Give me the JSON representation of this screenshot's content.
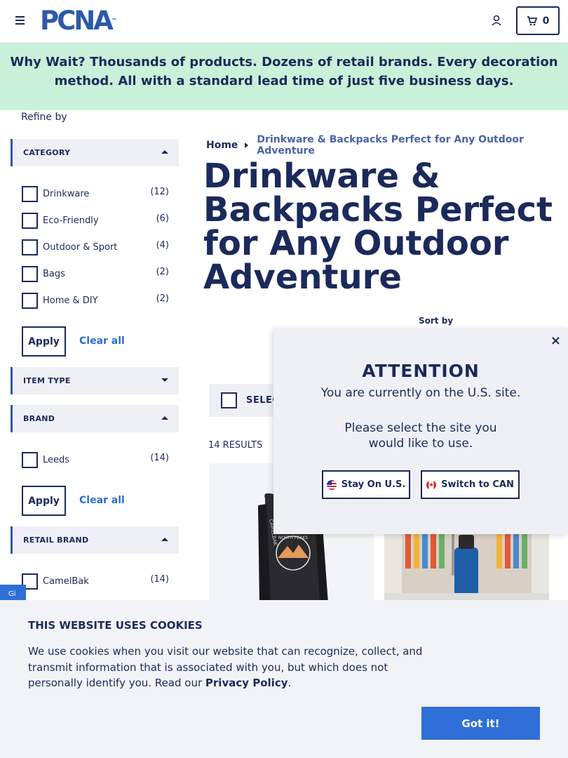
{
  "header": {
    "logo_text": "PCNA",
    "logo_mark": "™",
    "cart_count": "0"
  },
  "banner": {
    "lead": "Why Wait?",
    "text": " Thousands of products. Dozens of retail brands. Every decoration method. All with a standard lead time of just five business days."
  },
  "sidebar": {
    "refine_label": "Refine by",
    "category": {
      "title": "CATEGORY",
      "items": [
        {
          "label": "Drinkware",
          "count": "(12)"
        },
        {
          "label": "Eco-Friendly",
          "count": "(6)"
        },
        {
          "label": "Outdoor & Sport",
          "count": "(4)"
        },
        {
          "label": "Bags",
          "count": "(2)"
        },
        {
          "label": "Home & DIY",
          "count": "(2)"
        }
      ],
      "apply": "Apply",
      "clear": "Clear all"
    },
    "item_type": {
      "title": "ITEM TYPE"
    },
    "brand": {
      "title": "BRAND",
      "items": [
        {
          "label": "Leeds",
          "count": "(14)"
        }
      ],
      "apply": "Apply",
      "clear": "Clear all"
    },
    "retail_brand": {
      "title": "RETAIL BRAND",
      "items": [
        {
          "label": "CamelBak",
          "count": "(14)"
        }
      ]
    }
  },
  "main": {
    "breadcrumb_home": "Home",
    "breadcrumb_current": "Drinkware & Backpacks Perfect for Any Outdoor Adventure",
    "title": "Drinkware & Backpacks Perfect for Any Outdoor Adventure",
    "sort_by": "Sort by",
    "select_label": "SELEC",
    "results": "14 RESULTS"
  },
  "modal": {
    "title": "ATTENTION",
    "line1": "You are currently on the U.S. site.",
    "line2": "Please select the site you would like to use.",
    "stay_label": "Stay On U.S.",
    "switch_label": "Switch to CAN",
    "close": "×"
  },
  "cookie": {
    "title": "THIS WEBSITE USES COOKIES",
    "text": "We use cookies when you visit our website that can recognize, collect, and transmit information that is associated with you, but which does not personally identify you. Read our ",
    "link": "Privacy Policy",
    "end": ".",
    "button": "Got it!"
  },
  "side_tab": "Gi",
  "colors": {
    "navy": "#1b2a5b",
    "banner_green": "#c9f0d8",
    "accent_blue": "#2f6fd7"
  }
}
